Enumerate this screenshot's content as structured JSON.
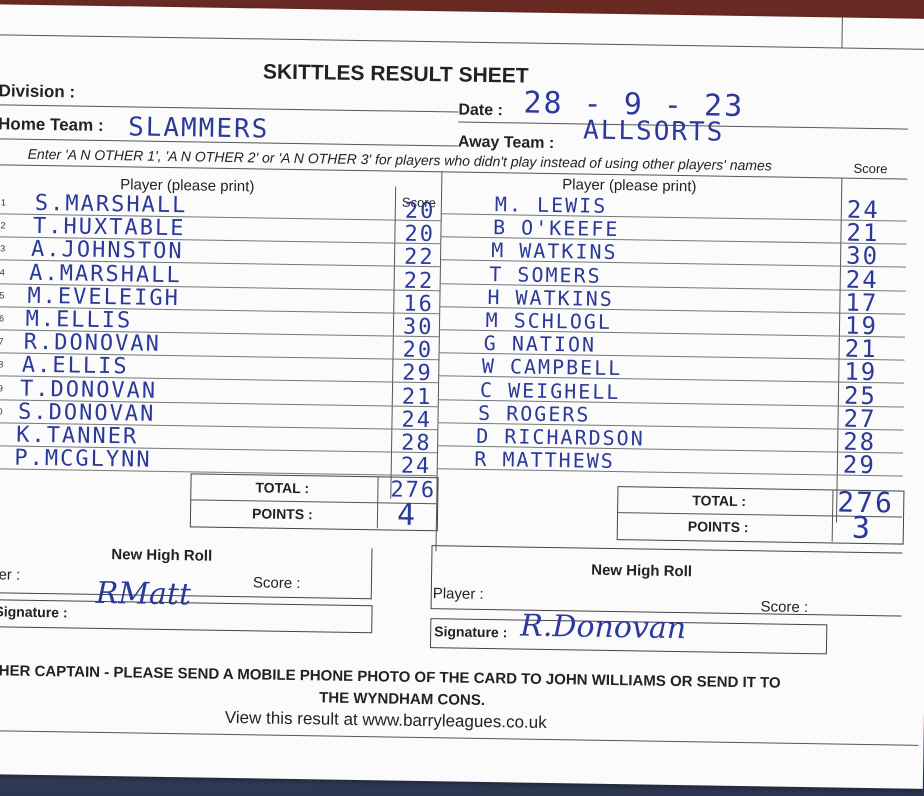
{
  "title": "SKITTLES RESULT SHEET",
  "labels": {
    "division": "Division :",
    "home_team": "Home Team :",
    "date": "Date :",
    "away_team": "Away Team :",
    "instructions": "Enter 'A N OTHER 1', 'A N OTHER 2' or 'A N OTHER 3' for players who didn't play instead of using other players' names",
    "player_header": "Player (please print)",
    "score_header": "Score",
    "total": "TOTAL :",
    "points": "POINTS :",
    "new_high_roll": "New High Roll",
    "player": "Player :",
    "player_partial": "ver :",
    "score": "Score :",
    "signature": "Signature :"
  },
  "values": {
    "home_team": "SLAMMERS",
    "date": "28 - 9 - 23",
    "away_team": "ALLSORTS"
  },
  "row_numbers": [
    "1",
    "2",
    "3",
    "4",
    "5",
    "6",
    "7",
    "8",
    "9",
    "0"
  ],
  "home": {
    "players": [
      {
        "name": "S.MARSHALL",
        "score": "20"
      },
      {
        "name": "T.HUXTABLE",
        "score": "20"
      },
      {
        "name": "A.JOHNSTON",
        "score": "22"
      },
      {
        "name": "A.MARSHALL",
        "score": "22"
      },
      {
        "name": "M.EVELEIGH",
        "score": "16"
      },
      {
        "name": "M.ELLIS",
        "score": "30"
      },
      {
        "name": "R.DONOVAN",
        "score": "20"
      },
      {
        "name": "A.ELLIS",
        "score": "29"
      },
      {
        "name": "T.DONOVAN",
        "score": "21"
      },
      {
        "name": "S.DONOVAN",
        "score": "24"
      },
      {
        "name": "K.TANNER",
        "score": "28"
      },
      {
        "name": "P.MCGLYNN",
        "score": "24"
      }
    ],
    "total": "276",
    "points": "4",
    "signature": "RMatt"
  },
  "away": {
    "players": [
      {
        "name": "M. LEWIS",
        "score": "24"
      },
      {
        "name": "B O'KEEFE",
        "score": "21"
      },
      {
        "name": "M WATKINS",
        "score": "30"
      },
      {
        "name": "T SOMERS",
        "score": "24"
      },
      {
        "name": "H WATKINS",
        "score": "17"
      },
      {
        "name": "M SCHLOGL",
        "score": "19"
      },
      {
        "name": "G NATION",
        "score": "21"
      },
      {
        "name": "W CAMPBELL",
        "score": "19"
      },
      {
        "name": "C WEIGHELL",
        "score": "25"
      },
      {
        "name": "S ROGERS",
        "score": "27"
      },
      {
        "name": "D RICHARDSON",
        "score": "28"
      },
      {
        "name": "R MATTHEWS",
        "score": "29"
      }
    ],
    "total": "276",
    "points": "3",
    "signature": "R.Donovan"
  },
  "footer": {
    "line1": "THER CAPTAIN - PLEASE SEND A MOBILE PHONE PHOTO OF THE CARD TO JOHN WILLIAMS OR SEND IT TO",
    "line2": "THE WYNDHAM CONS.",
    "line3": "View this result at www.barryleagues.co.uk"
  }
}
